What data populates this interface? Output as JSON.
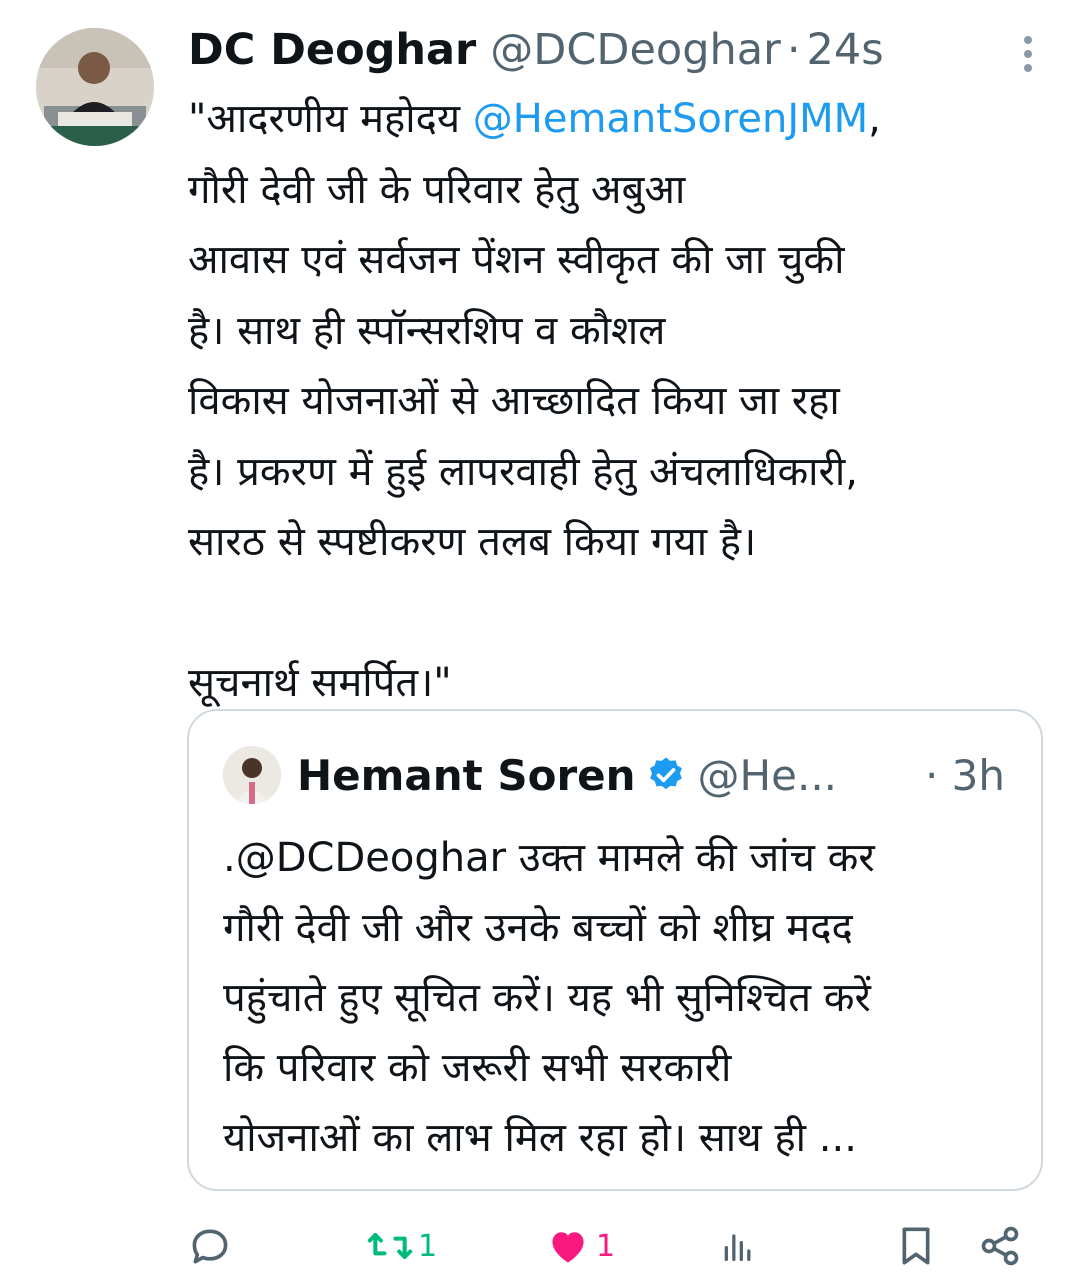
{
  "tweet": {
    "author_name": "DC Deoghar",
    "author_handle": "@DCDeoghar",
    "separator": "·",
    "time": "24s",
    "text_open_quote": "\"आदरणीय महोदय ",
    "mention": "@HemantSorenJMM",
    "text_rest": ",\nगौरी देवी जी के परिवार हेतु अबुआ\nआवास एवं सर्वजन पेंशन स्वीकृत की जा चुकी\nहै। साथ ही स्पॉन्सरशिप व कौशल\nविकास योजनाओं से आच्छादित किया जा रहा\nहै। प्रकरण में हुई लापरवाही हेतु अंचलाधिकारी,\nसारठ से स्पष्टीकरण तलब किया गया है।\n\nसूचनार्थ समर्पित।\""
  },
  "quoted_tweet": {
    "author_name": "Hemant Soren",
    "author_handle": "@He...",
    "separator": "·",
    "time": "3h",
    "text": ".@DCDeoghar उक्त मामले की जांच कर\nगौरी देवी जी और उनके बच्चों को शीघ्र मदद\nपहुंचाते हुए सूचित करें। यह भी सुनिश्चित करें\nकि परिवार को जरूरी सभी सरकारी\nयोजनाओं का लाभ मिल रहा हो। साथ ही ..."
  },
  "actions": {
    "retweet_count": "1",
    "like_count": "1"
  },
  "icons": [
    "more-vertical-icon",
    "verified-badge-icon",
    "reply-icon",
    "retweet-icon",
    "like-heart-icon",
    "views-icon",
    "bookmark-icon",
    "share-icon"
  ],
  "colors": {
    "mention": "#1d9bf0",
    "secondary_text": "#536471",
    "retweet_active": "#00ba7c",
    "like_active": "#f91880",
    "verified": "#1d9bf0"
  }
}
